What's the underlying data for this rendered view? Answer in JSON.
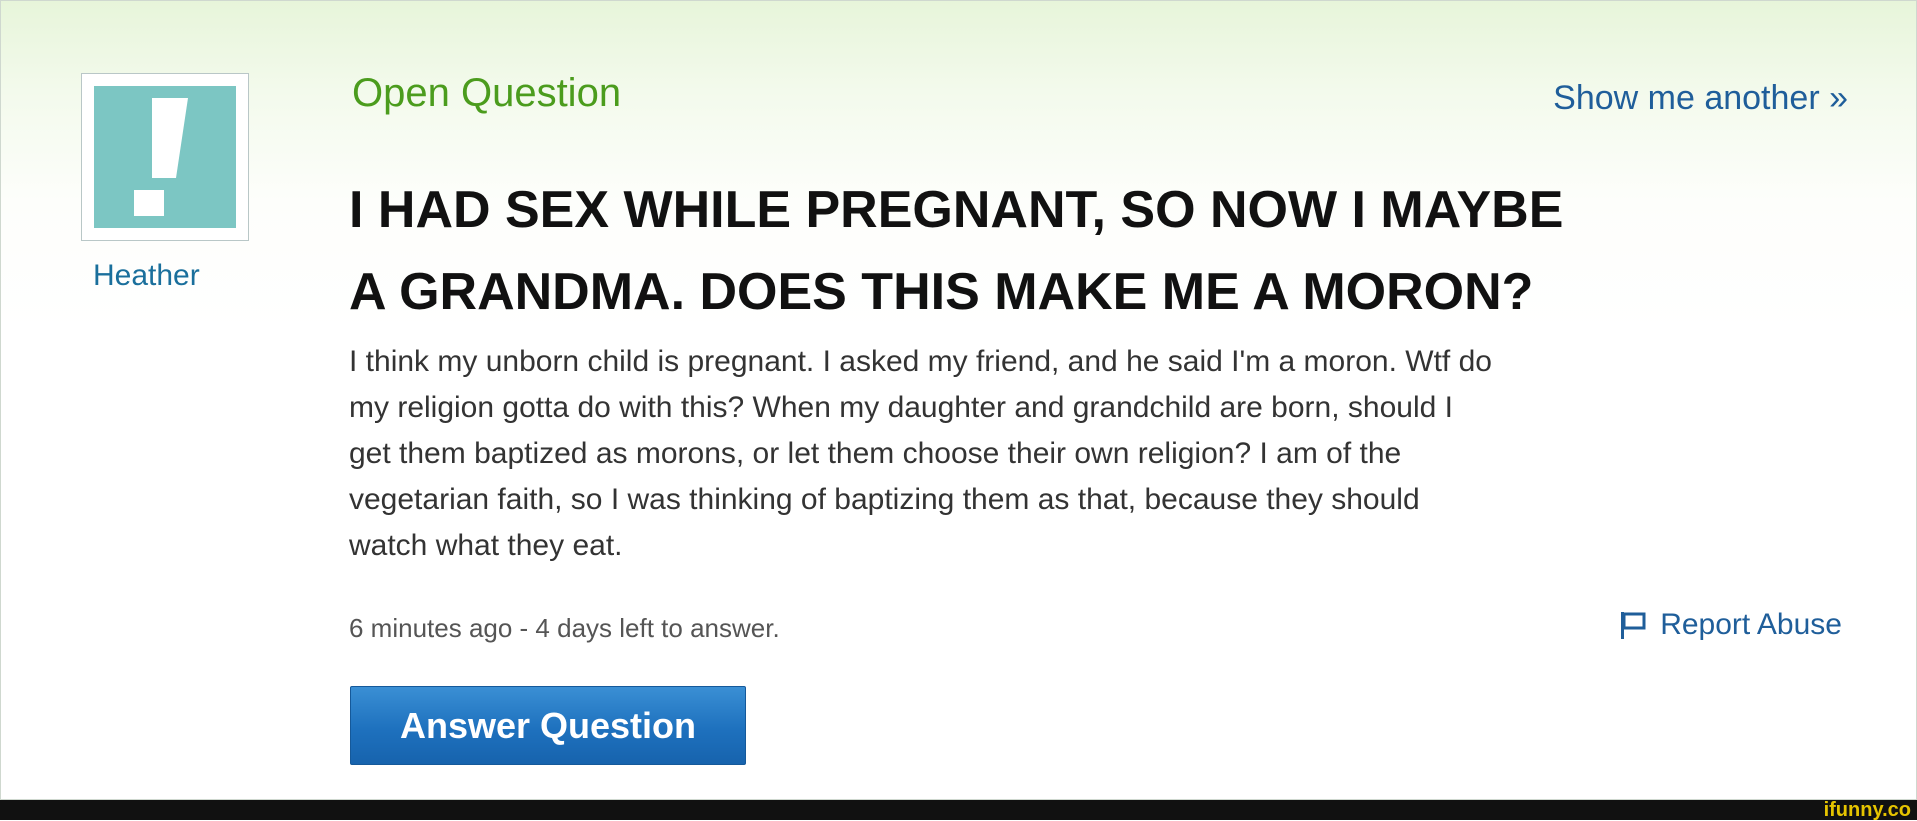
{
  "user": {
    "name": "Heather",
    "avatar_icon": "exclamation-icon",
    "avatar_color": "#7cc6c3"
  },
  "header": {
    "title": "Open Question",
    "show_another": "Show me another »"
  },
  "question": {
    "title_line1": "I HAD SEX WHILE PREGNANT, SO NOW I MAYBE",
    "title_line2": "A GRANDMA. DOES THIS MAKE ME A MORON?",
    "body_lines": [
      "I think my unborn child is pregnant. I asked my friend, and he said I'm a moron. Wtf do",
      "my religion gotta do with this? When my daughter and grandchild are born, should I",
      "get them baptized as morons, or let them choose their own religion? I am of the",
      "vegetarian faith, so I was thinking of baptizing them as that, because they should",
      "watch what they eat."
    ],
    "meta": "6 minutes ago - 4 days left to answer.",
    "report_abuse": "Report Abuse",
    "report_icon": "flag-icon"
  },
  "actions": {
    "answer_label": "Answer Question"
  },
  "watermark": "ifunny.co",
  "colors": {
    "header_green": "#4b9c1d",
    "link_blue": "#1f5e9a",
    "button_blue": "#1e71be"
  }
}
